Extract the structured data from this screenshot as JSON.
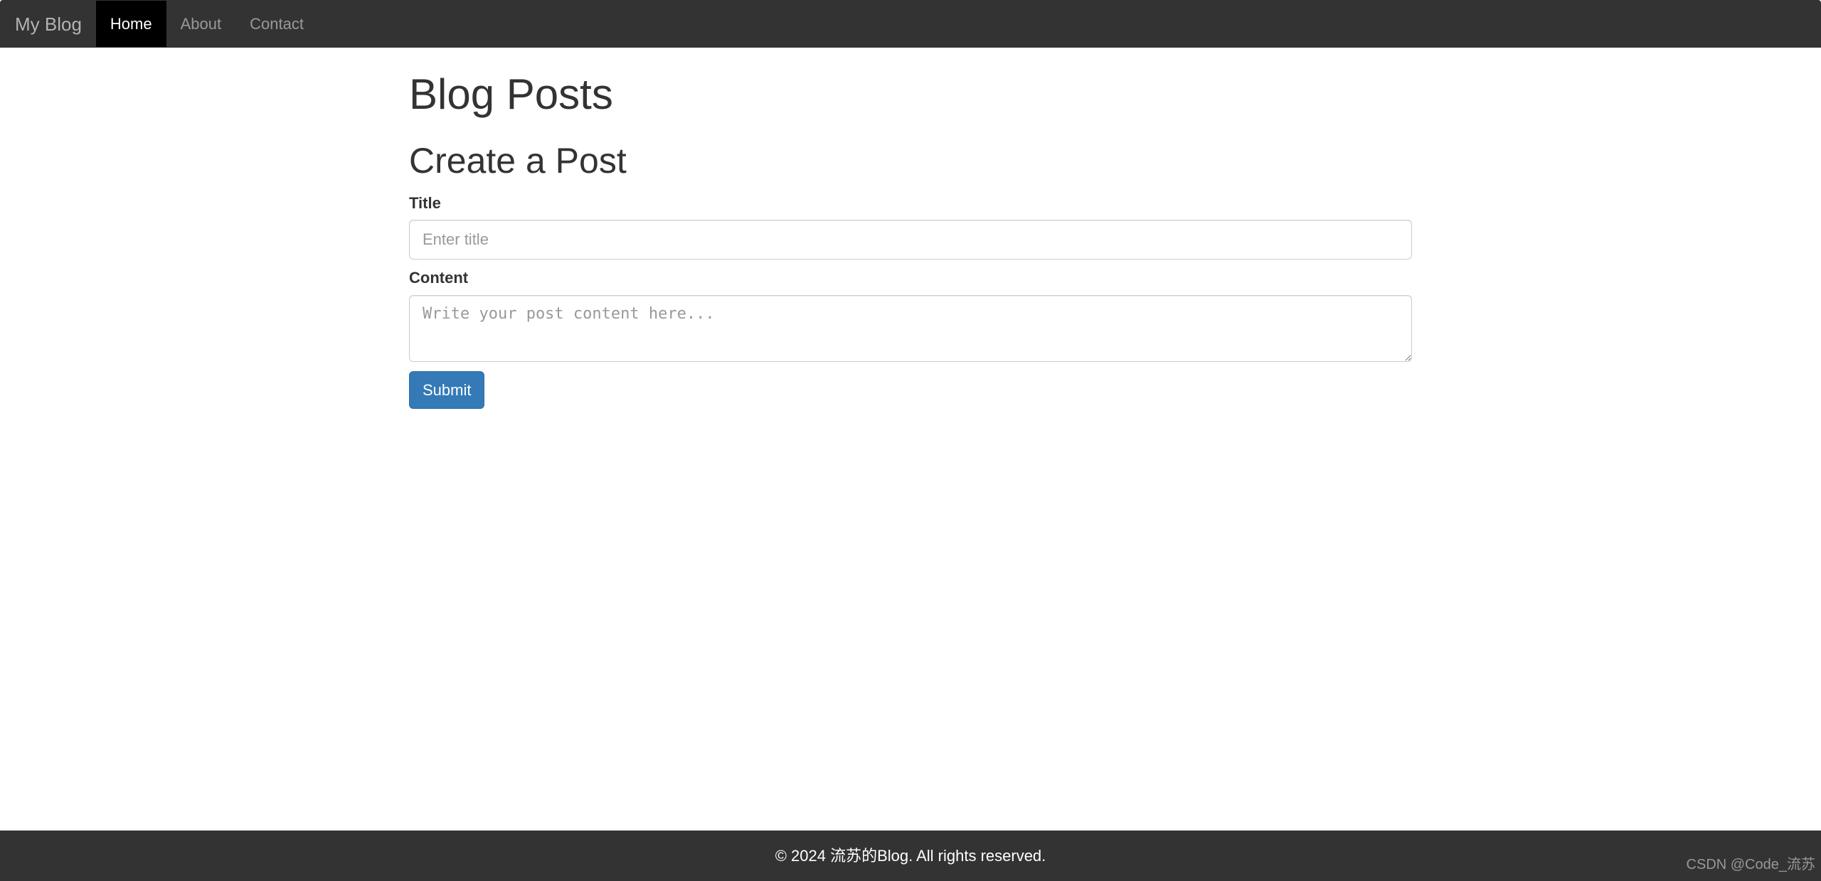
{
  "navbar": {
    "brand": "My Blog",
    "items": [
      {
        "label": "Home",
        "active": true
      },
      {
        "label": "About",
        "active": false
      },
      {
        "label": "Contact",
        "active": false
      }
    ]
  },
  "main": {
    "page_heading": "Blog Posts",
    "form_heading": "Create a Post",
    "title_label": "Title",
    "title_placeholder": "Enter title",
    "title_value": "",
    "content_label": "Content",
    "content_placeholder": "Write your post content here...",
    "content_value": "",
    "submit_label": "Submit"
  },
  "footer": {
    "text": "© 2024 流苏的Blog. All rights reserved."
  },
  "watermark": "CSDN @Code_流苏"
}
